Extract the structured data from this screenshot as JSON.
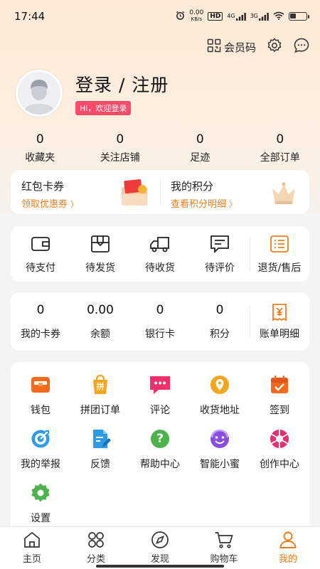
{
  "status_bar": {
    "time": "17:44",
    "speed_value": "0.00",
    "speed_unit": "KB/s",
    "hd_label": "HD",
    "net1": "4G",
    "net2": "3G"
  },
  "header": {
    "member_code": "会员码"
  },
  "profile": {
    "login_title": "登录 / 注册",
    "welcome": "Hi，欢迎登录"
  },
  "stats": [
    {
      "value": "0",
      "label": "收藏夹"
    },
    {
      "value": "0",
      "label": "关注店铺"
    },
    {
      "value": "0",
      "label": "足迹"
    },
    {
      "value": "0",
      "label": "全部订单"
    }
  ],
  "coupon": {
    "left_title": "红包卡券",
    "left_link": "领取优惠券",
    "right_title": "我的积分",
    "right_link": "查看积分明细",
    "chevron": "〉"
  },
  "orders": [
    {
      "label": "待支付",
      "icon": "wallet-icon"
    },
    {
      "label": "待发货",
      "icon": "package-icon"
    },
    {
      "label": "待收货",
      "icon": "truck-icon"
    },
    {
      "label": "待评价",
      "icon": "comment-icon"
    },
    {
      "label": "退货/售后",
      "icon": "return-list-icon"
    }
  ],
  "assets": [
    {
      "value": "0",
      "label": "我的卡券"
    },
    {
      "value": "0.00",
      "label": "余额"
    },
    {
      "value": "0",
      "label": "银行卡"
    },
    {
      "value": "0",
      "label": "积分"
    },
    {
      "label": "账单明细",
      "icon": "bill-icon"
    }
  ],
  "services": [
    {
      "label": "钱包",
      "icon": "wallet-box-icon"
    },
    {
      "label": "拼团订单",
      "icon": "group-buy-icon",
      "icon_text": "拼"
    },
    {
      "label": "评论",
      "icon": "chat-icon"
    },
    {
      "label": "收货地址",
      "icon": "location-icon"
    },
    {
      "label": "签到",
      "icon": "calendar-check-icon"
    },
    {
      "label": "我的举报",
      "icon": "target-icon"
    },
    {
      "label": "反馈",
      "icon": "feedback-icon"
    },
    {
      "label": "帮助中心",
      "icon": "help-icon",
      "icon_text": "?"
    },
    {
      "label": "智能小蜜",
      "icon": "smiley-icon"
    },
    {
      "label": "创作中心",
      "icon": "aperture-icon"
    },
    {
      "label": "设置",
      "icon": "settings-gear-icon"
    }
  ],
  "tabs": [
    {
      "label": "主页",
      "icon": "home-icon"
    },
    {
      "label": "分类",
      "icon": "category-icon"
    },
    {
      "label": "发现",
      "icon": "compass-icon"
    },
    {
      "label": "购物车",
      "icon": "cart-icon"
    },
    {
      "label": "我的",
      "icon": "user-icon",
      "active": true
    }
  ],
  "colors": {
    "accent": "#f07d1a",
    "badge": "#ff4a6a",
    "header_bg": "#fde9d6"
  }
}
